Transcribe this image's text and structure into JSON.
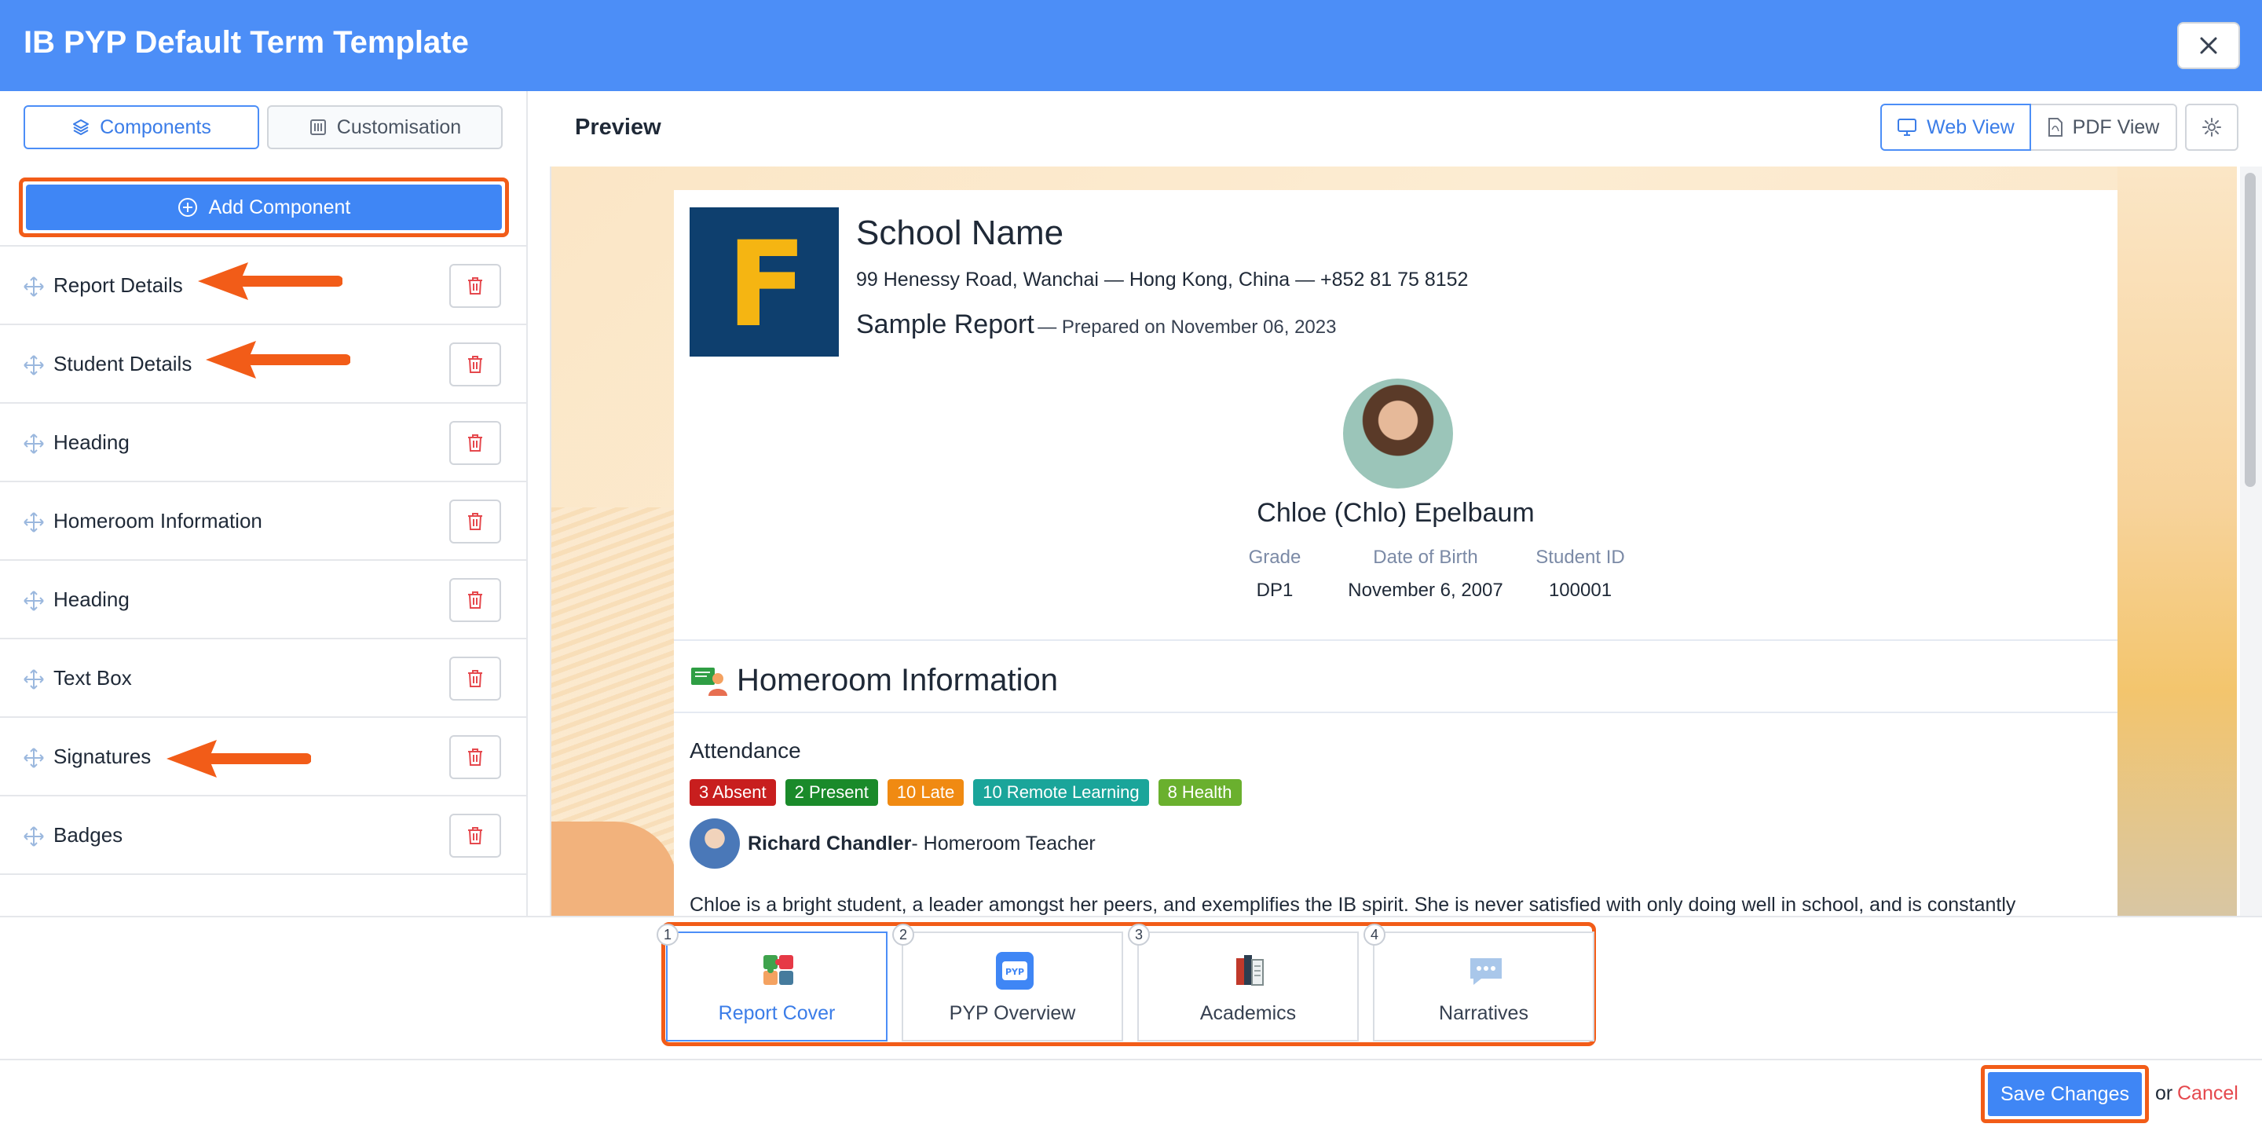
{
  "header": {
    "title": "IB PYP Default Term Template"
  },
  "sidebar": {
    "tabs": {
      "components": "Components",
      "customisation": "Customisation"
    },
    "add_component": "Add Component",
    "items": [
      {
        "label": "Report Details"
      },
      {
        "label": "Student Details"
      },
      {
        "label": "Heading"
      },
      {
        "label": "Homeroom Information"
      },
      {
        "label": "Heading"
      },
      {
        "label": "Text Box"
      },
      {
        "label": "Signatures"
      },
      {
        "label": "Badges"
      }
    ]
  },
  "preview": {
    "title": "Preview",
    "views": {
      "web": "Web View",
      "pdf": "PDF View"
    },
    "report": {
      "logo_letter": "F",
      "school_name": "School Name",
      "address": "99 Henessy Road, Wanchai — Hong Kong, China — +852 81 75 8152",
      "sample_title": "Sample Report",
      "prepared": "— Prepared on November 06, 2023",
      "student_name": "Chloe (Chlo) Epelbaum",
      "info": {
        "grade_label": "Grade",
        "grade": "DP1",
        "dob_label": "Date of Birth",
        "dob": "November 6, 2007",
        "id_label": "Student ID",
        "id": "100001"
      },
      "homeroom_heading": "Homeroom Information",
      "attendance_title": "Attendance",
      "attendance_badges": [
        {
          "text": "3 Absent",
          "color": "#c81e1e"
        },
        {
          "text": "2 Present",
          "color": "#1a8a2a"
        },
        {
          "text": "10 Late",
          "color": "#f08a12"
        },
        {
          "text": "10 Remote Learning",
          "color": "#1aa59a"
        },
        {
          "text": "8 Health",
          "color": "#6ab02e"
        }
      ],
      "teacher_name": "Richard Chandler",
      "teacher_role": "- Homeroom Teacher",
      "narrative": "Chloe is a bright student, a leader amongst her peers, and exemplifies the IB spirit. She is never satisfied with only doing well in school, and is constantly"
    }
  },
  "pages": [
    {
      "number": "1",
      "label": "Report Cover",
      "icon": "puzzle-icon"
    },
    {
      "number": "2",
      "label": "PYP Overview",
      "icon": "pyp-icon"
    },
    {
      "number": "3",
      "label": "Academics",
      "icon": "books-icon"
    },
    {
      "number": "4",
      "label": "Narratives",
      "icon": "speech-bubble-icon"
    }
  ],
  "pyp_icon_text": "PYP",
  "footer": {
    "save": "Save Changes",
    "or": "or",
    "cancel": "Cancel"
  },
  "colors": {
    "accent": "#4c8ef7",
    "highlight": "#f25c18",
    "danger": "#e5484d"
  }
}
